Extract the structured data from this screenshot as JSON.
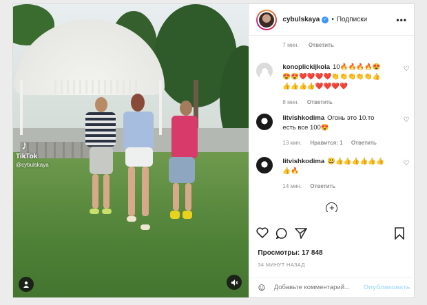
{
  "header": {
    "username": "cybulskaya",
    "follow_label": "Подписки",
    "dot": "•"
  },
  "media": {
    "tiktok_logo": "♪",
    "tiktok_label": "TikTok",
    "tiktok_user": "@cybulskaya"
  },
  "previous_comment": {
    "time": "7 мин.",
    "reply": "Ответить"
  },
  "comments": [
    {
      "user": "konoplickijkola",
      "text": "10🔥🔥🔥🔥😍😍😍❤️❤️❤️❤️👏👏👏👏👏👍👍👍👍👍❤️❤️❤️❤️",
      "time": "8 мин.",
      "likes": "",
      "reply": "Ответить"
    },
    {
      "user": "litvishkodima",
      "text": "Огонь это 10.то есть все 100😍",
      "time": "13 мин.",
      "likes": "Нравится: 1",
      "reply": "Ответить"
    },
    {
      "user": "litvishkodima",
      "text": "😃👍👍👍👍👍👍👍🔥",
      "time": "14 мин.",
      "likes": "",
      "reply": "Ответить"
    }
  ],
  "stats": {
    "views": "Просмотры: 17 848",
    "ago": "34 МИНУТ НАЗАД"
  },
  "composer": {
    "placeholder": "Добавьте комментарий...",
    "publish": "Опубликовать"
  },
  "colors": {
    "verified": "#3897f0",
    "publish": "#b2dffc"
  }
}
